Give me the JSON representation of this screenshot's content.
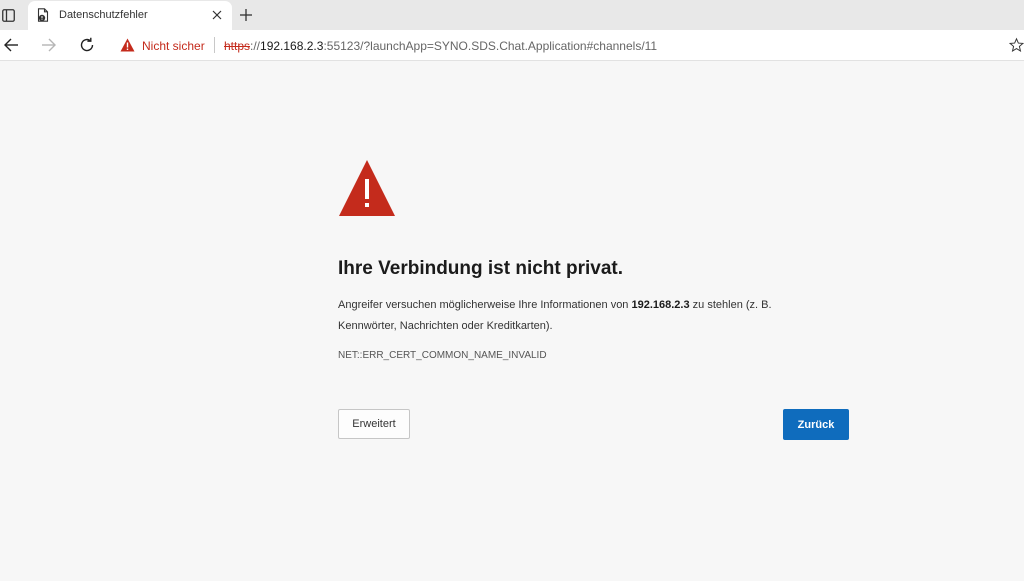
{
  "browser": {
    "tab": {
      "title": "Datenschutzfehler",
      "favicon": "page-warning-icon",
      "close_icon": "close-icon"
    },
    "new_tab_icon": "plus-icon",
    "toolbar": {
      "back_icon": "arrow-left-icon",
      "forward_icon": "arrow-right-icon",
      "reload_icon": "reload-icon",
      "favorite_icon": "star-icon"
    },
    "address": {
      "security_icon": "warning-triangle-icon",
      "security_label": "Nicht sicher",
      "url_scheme": "https",
      "url_separator": "://",
      "url_host": "192.168.2.3",
      "url_rest": ":55123/?launchApp=SYNO.SDS.Chat.Application#channels/11"
    }
  },
  "error_page": {
    "icon": "warning-triangle-icon",
    "heading": "Ihre Verbindung ist nicht privat.",
    "description_before": "Angreifer versuchen möglicherweise Ihre Informationen von ",
    "description_host": "192.168.2.3",
    "description_after": " zu stehlen (z. B. Kennwörter, Nachrichten oder Kreditkarten).",
    "error_code": "NET::ERR_CERT_COMMON_NAME_INVALID",
    "advanced_button": "Erweitert",
    "back_button": "Zurück"
  },
  "colors": {
    "danger": "#c42b1c",
    "primary_button": "#0f6cbd",
    "page_background": "#f7f7f7"
  }
}
